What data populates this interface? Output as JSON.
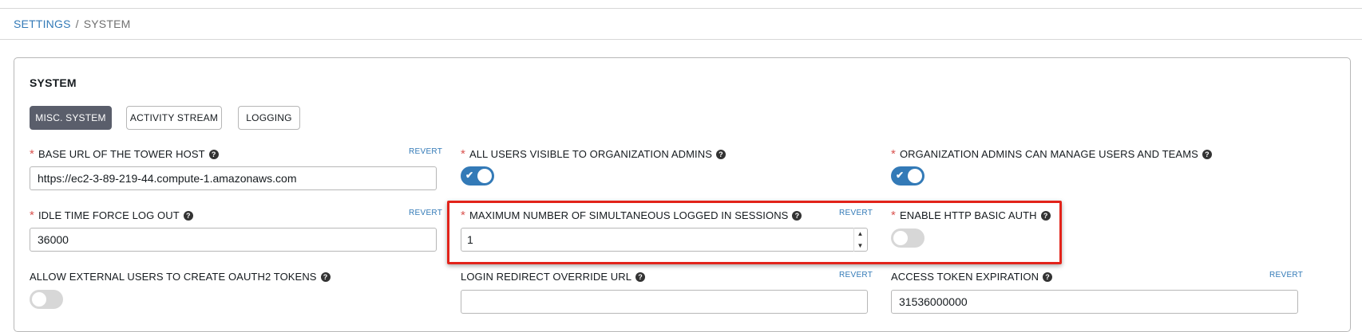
{
  "breadcrumb": {
    "settings": "SETTINGS",
    "separator": "/",
    "current": "SYSTEM"
  },
  "panel": {
    "title": "SYSTEM"
  },
  "tabs": [
    {
      "label": "MISC. SYSTEM",
      "active": true
    },
    {
      "label": "ACTIVITY STREAM",
      "active": false
    },
    {
      "label": "LOGGING",
      "active": false
    }
  ],
  "fields": {
    "base_url": {
      "label": "BASE URL OF THE TOWER HOST",
      "required": "*",
      "revert": "REVERT",
      "value": "https://ec2-3-89-219-44.compute-1.amazonaws.com"
    },
    "all_users_visible": {
      "label": "ALL USERS VISIBLE TO ORGANIZATION ADMINS",
      "required": "*",
      "state": "on"
    },
    "org_admins_manage": {
      "label": "ORGANIZATION ADMINS CAN MANAGE USERS AND TEAMS",
      "required": "*",
      "state": "on"
    },
    "idle_timeout": {
      "label": "IDLE TIME FORCE LOG OUT",
      "required": "*",
      "revert": "REVERT",
      "value": "36000"
    },
    "max_sessions": {
      "label": "MAXIMUM NUMBER OF SIMULTANEOUS LOGGED IN SESSIONS",
      "required": "*",
      "revert": "REVERT",
      "value": "1"
    },
    "http_basic_auth": {
      "label": "ENABLE HTTP BASIC AUTH",
      "required": "*",
      "state": "off"
    },
    "external_oauth2": {
      "label": "ALLOW EXTERNAL USERS TO CREATE OAUTH2 TOKENS",
      "state": "off"
    },
    "login_redirect": {
      "label": "LOGIN REDIRECT OVERRIDE URL",
      "revert": "REVERT",
      "value": ""
    },
    "access_token_exp": {
      "label": "ACCESS TOKEN EXPIRATION",
      "revert": "REVERT",
      "value": "31536000000"
    }
  },
  "icons": {
    "help": "question-circle-icon",
    "check": "checkmark-icon",
    "step_up": "chevron-up-icon",
    "step_down": "chevron-down-icon"
  },
  "colors": {
    "accent": "#337ab7",
    "required": "#d9534f",
    "highlight": "#e2231a",
    "active_tab": "#5a5e6b"
  }
}
